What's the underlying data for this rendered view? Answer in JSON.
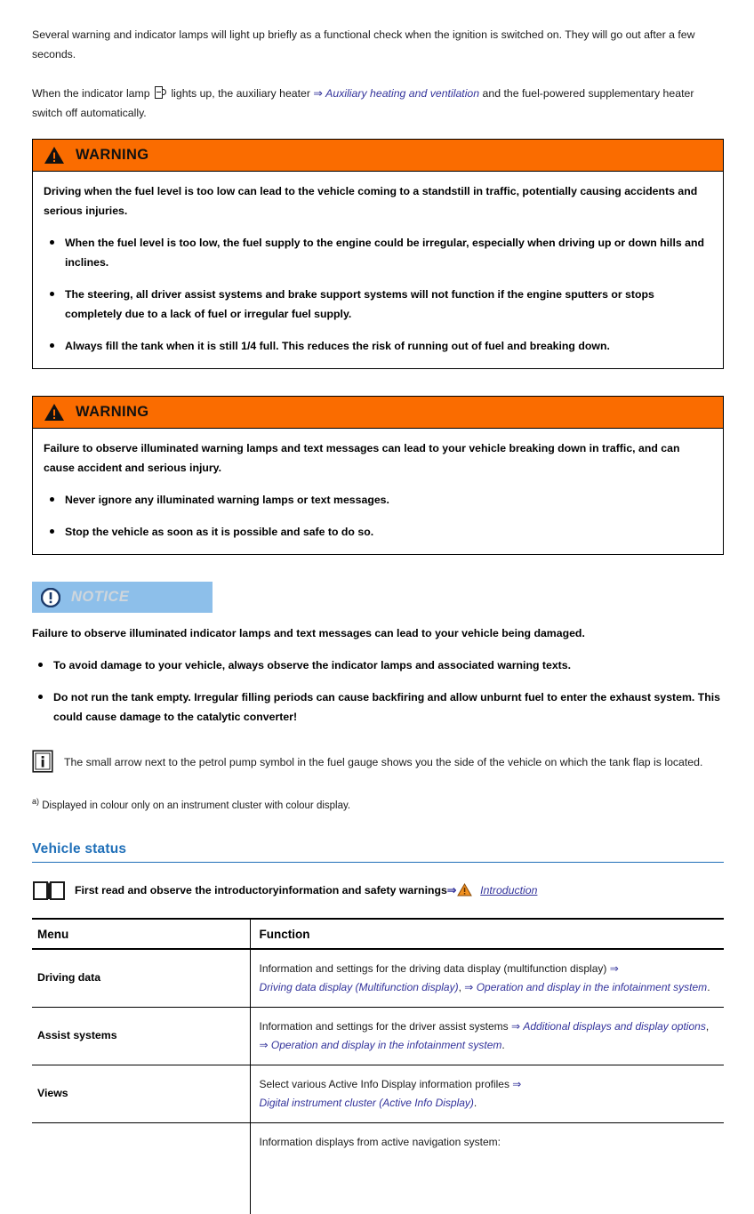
{
  "intro": {
    "paragraph1": "Several warning and indicator lamps will light up briefly as a functional check when the ignition is switched on. They will go out after a few seconds.",
    "paragraph2_part1": "When the indicator lamp",
    "paragraph2_part2": "lights up, the auxiliary heater",
    "paragraph2_link": "Auxiliary heating and ventilation",
    "paragraph2_part3": "and the fuel-powered supplementary heater switch off automatically.",
    "lamp_icon": "auxiliary-heater-indicator-lamp-icon"
  },
  "warning1": {
    "title": "WARNING",
    "icon": "warning-triangle-icon",
    "lead": "Driving when the fuel level is too low can lead to the vehicle coming to a standstill in traffic, potentially causing accidents and serious injuries.",
    "bullets": [
      "When the fuel level is too low, the fuel supply to the engine could be irregular, especially when driving up or down hills and inclines.",
      "The steering, all driver assist systems and brake support systems will not function if the engine sputters or stops completely due to a lack of fuel or irregular fuel supply.",
      "Always fill the tank when it is still 1/4 full. This reduces the risk of running out of fuel and breaking down."
    ]
  },
  "warning2": {
    "title": "WARNING",
    "icon": "warning-triangle-icon",
    "lead": "Failure to observe illuminated warning lamps and text messages can lead to your vehicle breaking down in traffic, and can cause accident and serious injury.",
    "bullets": [
      "Never ignore any illuminated warning lamps or text messages.",
      "Stop the vehicle as soon as it is possible and safe to do so."
    ]
  },
  "notice": {
    "title": "NOTICE",
    "icon": "notice-exclamation-circle-icon",
    "lead": "Failure to observe illuminated indicator lamps and text messages can lead to your vehicle being damaged.",
    "bullets": [
      "To avoid damage to your vehicle, always observe the indicator lamps and associated warning texts.",
      "Do not run the tank empty. Irregular filling periods can cause backfiring and allow unburnt fuel to enter the exhaust system. This could cause damage to the catalytic converter!"
    ]
  },
  "info_note": {
    "icon": "information-i-icon",
    "text": "The small arrow next to the petrol pump symbol in the fuel gauge shows you the side of the vehicle on which the tank flap is located."
  },
  "footnote": {
    "marker": "a)",
    "text": "Displayed in colour only on an instrument cluster with colour display."
  },
  "section": {
    "heading": "Vehicle status",
    "read_first": {
      "icon": "open-book-icon",
      "text": "First read and observe the introductoryinformation and safety warnings",
      "arrow": "⇒",
      "triangle_icon": "orange-warning-triangle-icon",
      "link": "Introduction"
    }
  },
  "table": {
    "headers": [
      "Menu",
      "Function"
    ],
    "rows": [
      {
        "menu": "Driving data",
        "function_prefix": "Information and settings for the driving data display (multifunction display) ",
        "function_links": [
          "Driving data display (Multifunction display)",
          "Operation and display in the infotainment system"
        ],
        "function_plain_text": "Information and settings for the driving data display (multifunction display) ⇒ Driving data display (Multifunction display), ⇒ Operation and display in the infotainment system."
      },
      {
        "menu": "Assist systems",
        "function_prefix": "Information and settings for the driver assist systems ",
        "function_links": [
          "Additional displays and display options",
          "Operation and display in the infotainment system"
        ],
        "function_plain_text": "Information and settings for the driver assist systems ⇒ Additional displays and display options, ⇒ Operation and display in the infotainment system."
      },
      {
        "menu": "Views",
        "function_prefix": "Select various Active Info Display information profiles ",
        "function_links": [
          "Digital instrument cluster (Active Info Display)"
        ],
        "function_plain_text": "Select various Active Info Display information profiles ⇒ Digital instrument cluster (Active Info Display)."
      },
      {
        "menu": "",
        "function_prefix": "Information displays from active navigation system:",
        "function_links": [],
        "function_plain_text": "Information displays from active navigation system:"
      }
    ]
  },
  "colors": {
    "warning_orange": "#fa6c00",
    "notice_blue": "#8dbfea",
    "link_blue": "#33339b",
    "heading_blue": "#1f6fb8"
  }
}
